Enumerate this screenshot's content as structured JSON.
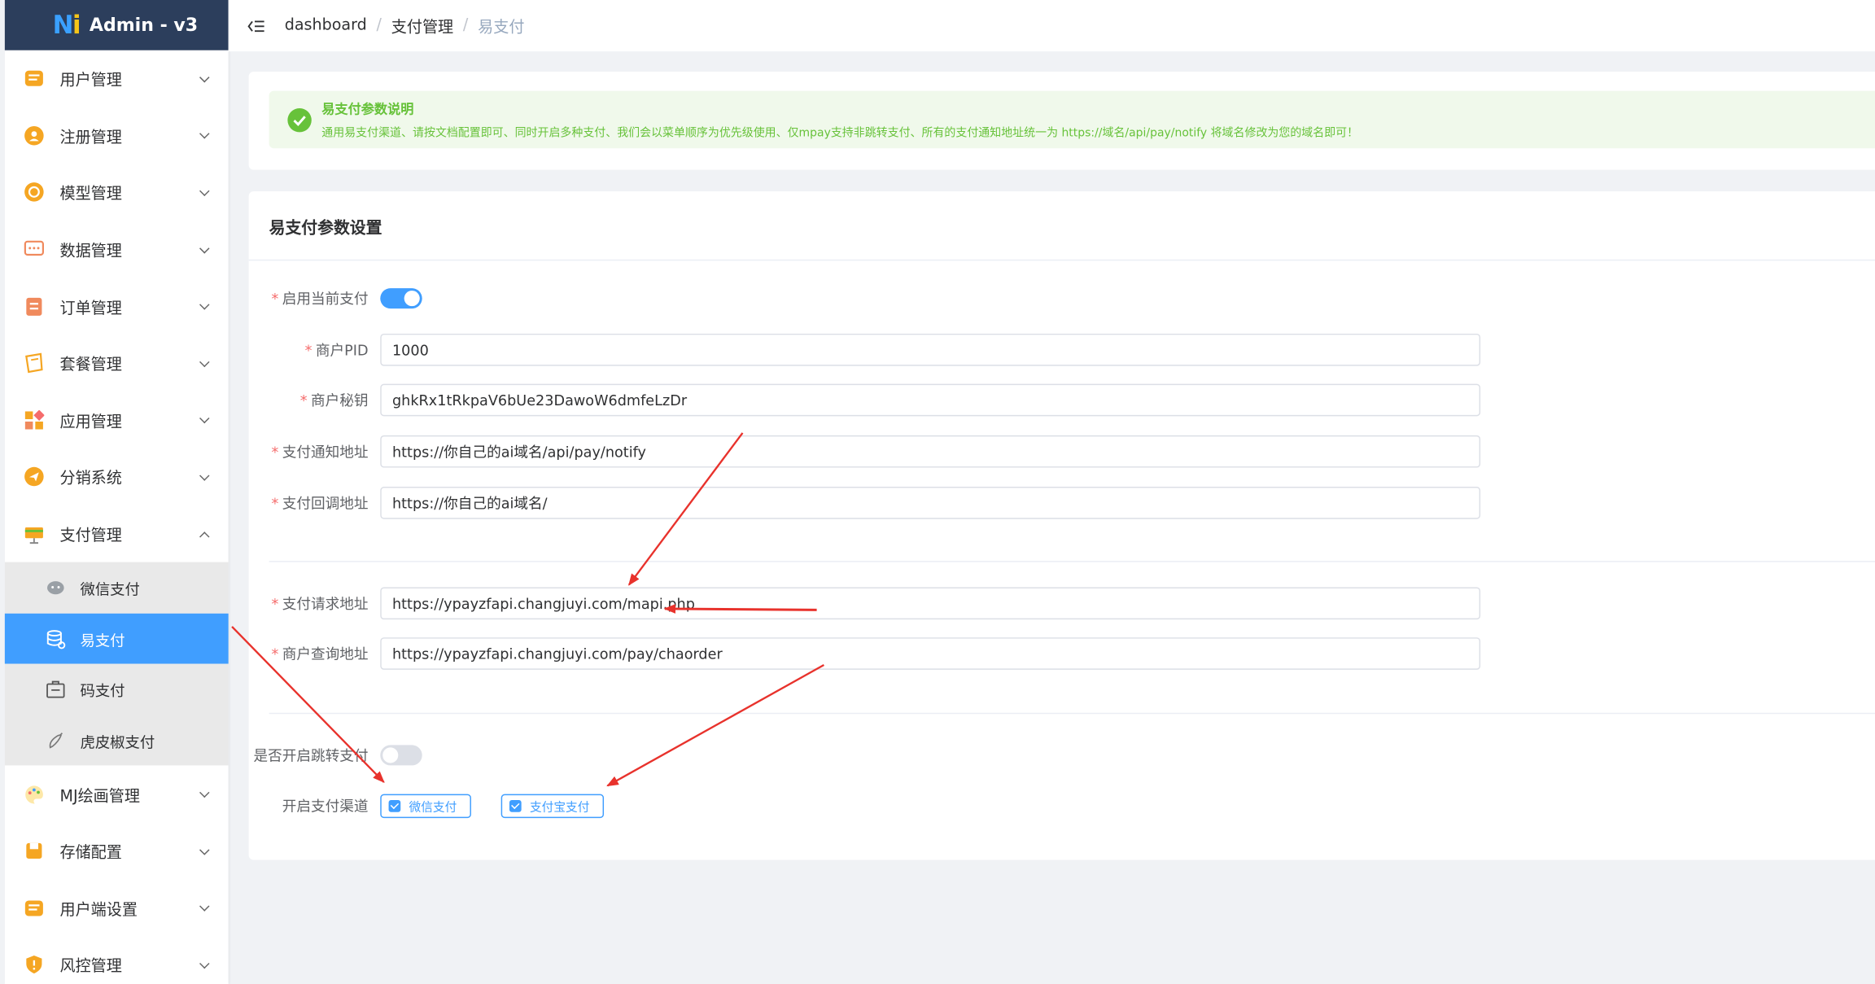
{
  "app": {
    "title": "Admin - v3"
  },
  "sidebar": {
    "items": [
      {
        "label": "用户管理",
        "icon": "user-list-icon",
        "color": "#f5a623",
        "expanded": false
      },
      {
        "label": "注册管理",
        "icon": "register-icon",
        "color": "#f5a623",
        "expanded": false
      },
      {
        "label": "模型管理",
        "icon": "model-icon",
        "color": "#f5a623",
        "expanded": false
      },
      {
        "label": "数据管理",
        "icon": "chat-data-icon",
        "color": "#f08a5d",
        "expanded": false
      },
      {
        "label": "订单管理",
        "icon": "order-icon",
        "color": "#f08a5d",
        "expanded": false
      },
      {
        "label": "套餐管理",
        "icon": "package-icon",
        "color": "#f5a623",
        "expanded": false
      },
      {
        "label": "应用管理",
        "icon": "apps-icon",
        "color": "#f5a623",
        "expanded": false
      },
      {
        "label": "分销系统",
        "icon": "distribution-icon",
        "color": "#f5a623",
        "expanded": false
      },
      {
        "label": "支付管理",
        "icon": "payment-icon",
        "color": "#f5a623",
        "expanded": true
      }
    ],
    "sub_items": [
      {
        "label": "微信支付",
        "icon": "wechat-icon",
        "active": false
      },
      {
        "label": "易支付",
        "icon": "database-icon",
        "active": true
      },
      {
        "label": "码支付",
        "icon": "bag-icon",
        "active": false
      },
      {
        "label": "虎皮椒支付",
        "icon": "pepper-icon",
        "active": false
      }
    ],
    "items_after": [
      {
        "label": "MJ绘画管理",
        "icon": "palette-icon",
        "color": "#f5a623",
        "expanded": false
      },
      {
        "label": "存储配置",
        "icon": "storage-icon",
        "color": "#f5a623",
        "expanded": false
      },
      {
        "label": "用户端设置",
        "icon": "client-settings-icon",
        "color": "#f5a623",
        "expanded": false
      },
      {
        "label": "风控管理",
        "icon": "shield-icon",
        "color": "#f5a623",
        "expanded": false
      }
    ]
  },
  "breadcrumb": {
    "items": [
      "dashboard",
      "支付管理",
      "易支付"
    ],
    "sep": "/"
  },
  "notice": {
    "title": "易支付参数说明",
    "desc": "通用易支付渠道、请按文档配置即可、同时开启多种支付、我们会以菜单顺序为优先级使用、仅mpay支持非跳转支付、所有的支付通知地址统一为 https://域名/api/pay/notify 将域名修改为您的域名即可！"
  },
  "form": {
    "title": "易支付参数设置",
    "enable_label": "启用当前支付",
    "enable_on": true,
    "pid_label": "商户PID",
    "pid_value": "1000",
    "secret_label": "商户秘钥",
    "secret_value": "ghkRx1tRkpaV6bUe23DawoW6dmfeLzDr",
    "notify_label": "支付通知地址",
    "notify_value": "https://你自己的ai域名/api/pay/notify",
    "return_label": "支付回调地址",
    "return_value": "https://你自己的ai域名/",
    "request_label": "支付请求地址",
    "request_value": "https://ypayzfapi.changjuyi.com/mapi.php",
    "query_label": "商户查询地址",
    "query_value": "https://ypayzfapi.changjuyi.com/pay/chaorder",
    "redirect_label": "是否开启跳转支付",
    "redirect_on": false,
    "channels_label": "开启支付渠道",
    "channels": [
      {
        "label": "微信支付",
        "checked": true
      },
      {
        "label": "支付宝支付",
        "checked": true
      }
    ]
  },
  "colors": {
    "primary": "#409eff",
    "success": "#67c23a",
    "danger": "#f56c6c",
    "arrow": "#e8322c",
    "logo_bg": "#2c3e5c"
  }
}
